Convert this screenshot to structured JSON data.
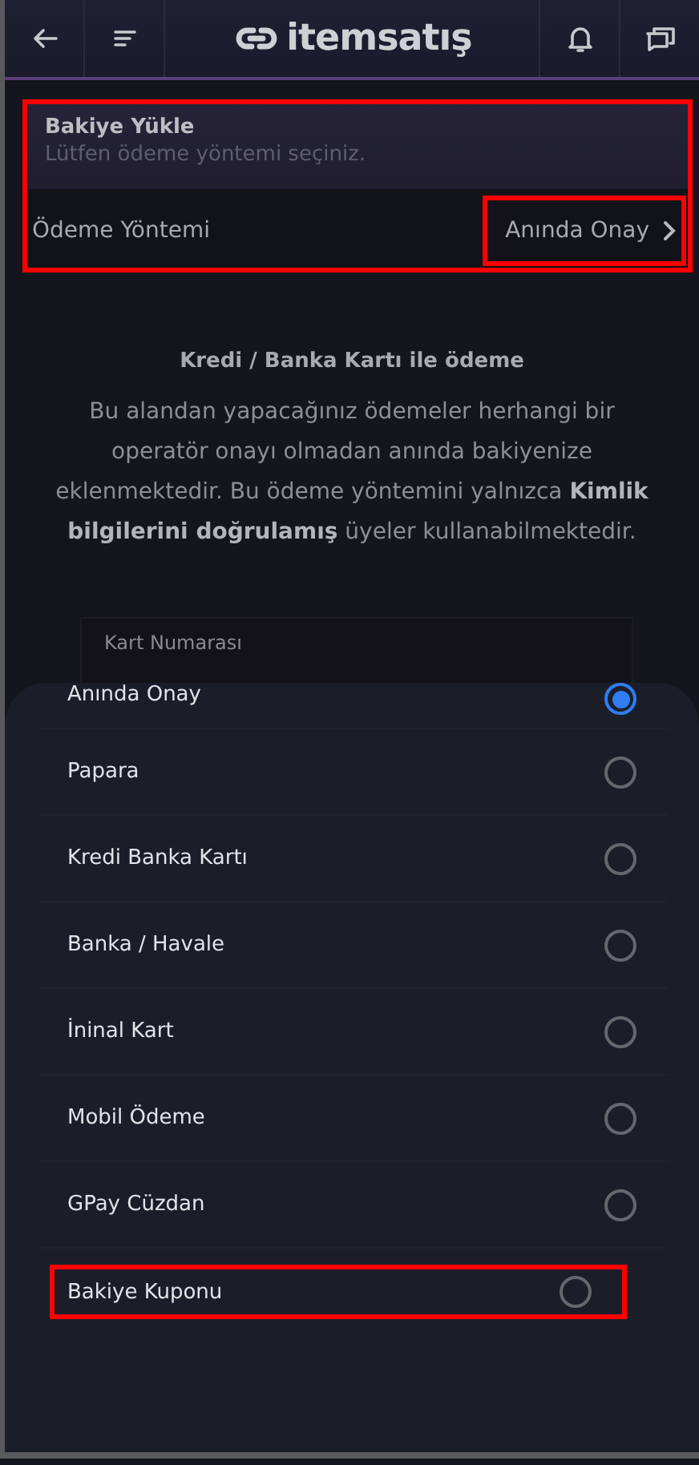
{
  "header": {
    "logo": "itemsatış"
  },
  "balance_panel": {
    "title": "Bakiye Yükle",
    "subtitle": "Lütfen ödeme yöntemi seçiniz.",
    "highlighted": true,
    "method_row": {
      "label": "Ödeme Yöntemi",
      "value": "Anında Onay",
      "value_highlighted": true
    }
  },
  "info": {
    "heading": "Kredi / Banka Kartı ile ödeme",
    "text": "Bu alandan yapacağınız ödemeler herhangi bir operatör onayı olmadan anında bakiyenize eklenmektedir. Bu ödeme yöntemini yalnızca **Kimlik bilgilerini doğrulamış** üyeler kullanabilmektedir."
  },
  "card_field": {
    "placeholder": "Kart Numarası"
  },
  "method_sheet": {
    "options": [
      {
        "label": "Anında Onay",
        "selected": true,
        "highlighted": false
      },
      {
        "label": "Papara",
        "selected": false,
        "highlighted": false
      },
      {
        "label": "Kredi Banka Kartı",
        "selected": false,
        "highlighted": false
      },
      {
        "label": "Banka / Havale",
        "selected": false,
        "highlighted": false
      },
      {
        "label": "İninal Kart",
        "selected": false,
        "highlighted": false
      },
      {
        "label": "Mobil Ödeme",
        "selected": false,
        "highlighted": false
      },
      {
        "label": "GPay Cüzdan",
        "selected": false,
        "highlighted": false
      },
      {
        "label": "Bakiye Kuponu",
        "selected": false,
        "highlighted": true
      }
    ]
  }
}
